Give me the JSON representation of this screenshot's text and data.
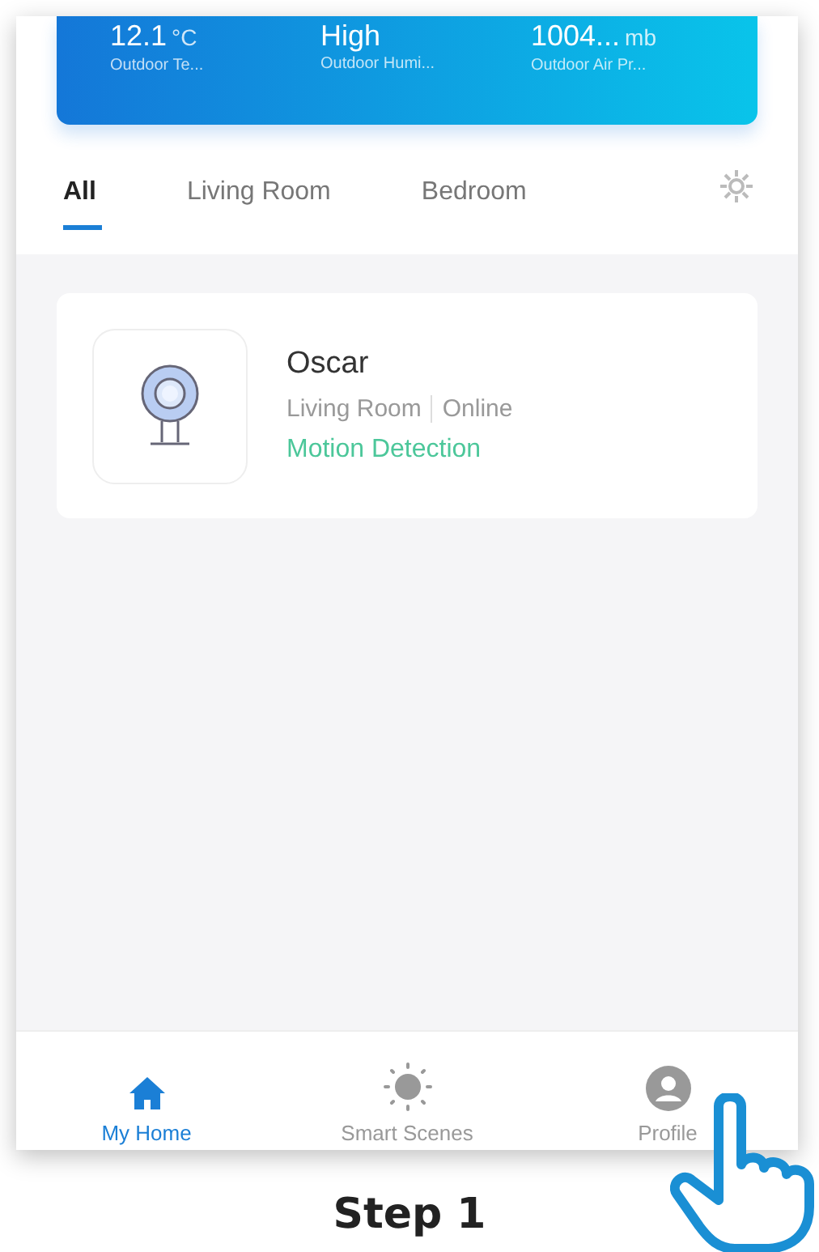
{
  "weather": [
    {
      "value": "12.1",
      "unit": "°C",
      "label": "Outdoor Te..."
    },
    {
      "value": "High",
      "label": "Outdoor Humi..."
    },
    {
      "value": "1004...",
      "unit": "mb",
      "label": "Outdoor Air Pr..."
    }
  ],
  "tabs": [
    {
      "label": "All",
      "selected": true
    },
    {
      "label": "Living Room",
      "selected": false
    },
    {
      "label": "Bedroom",
      "selected": false
    }
  ],
  "devices": [
    {
      "name": "Oscar",
      "room": "Living Room",
      "status": "Online",
      "mode": "Motion Detection"
    }
  ],
  "nav": [
    {
      "kind": "home",
      "label": "My Home",
      "selected": true
    },
    {
      "kind": "scenes",
      "label": "Smart Scenes",
      "selected": false
    },
    {
      "kind": "profile",
      "label": "Profile",
      "selected": false
    }
  ],
  "caption": "Step 1"
}
